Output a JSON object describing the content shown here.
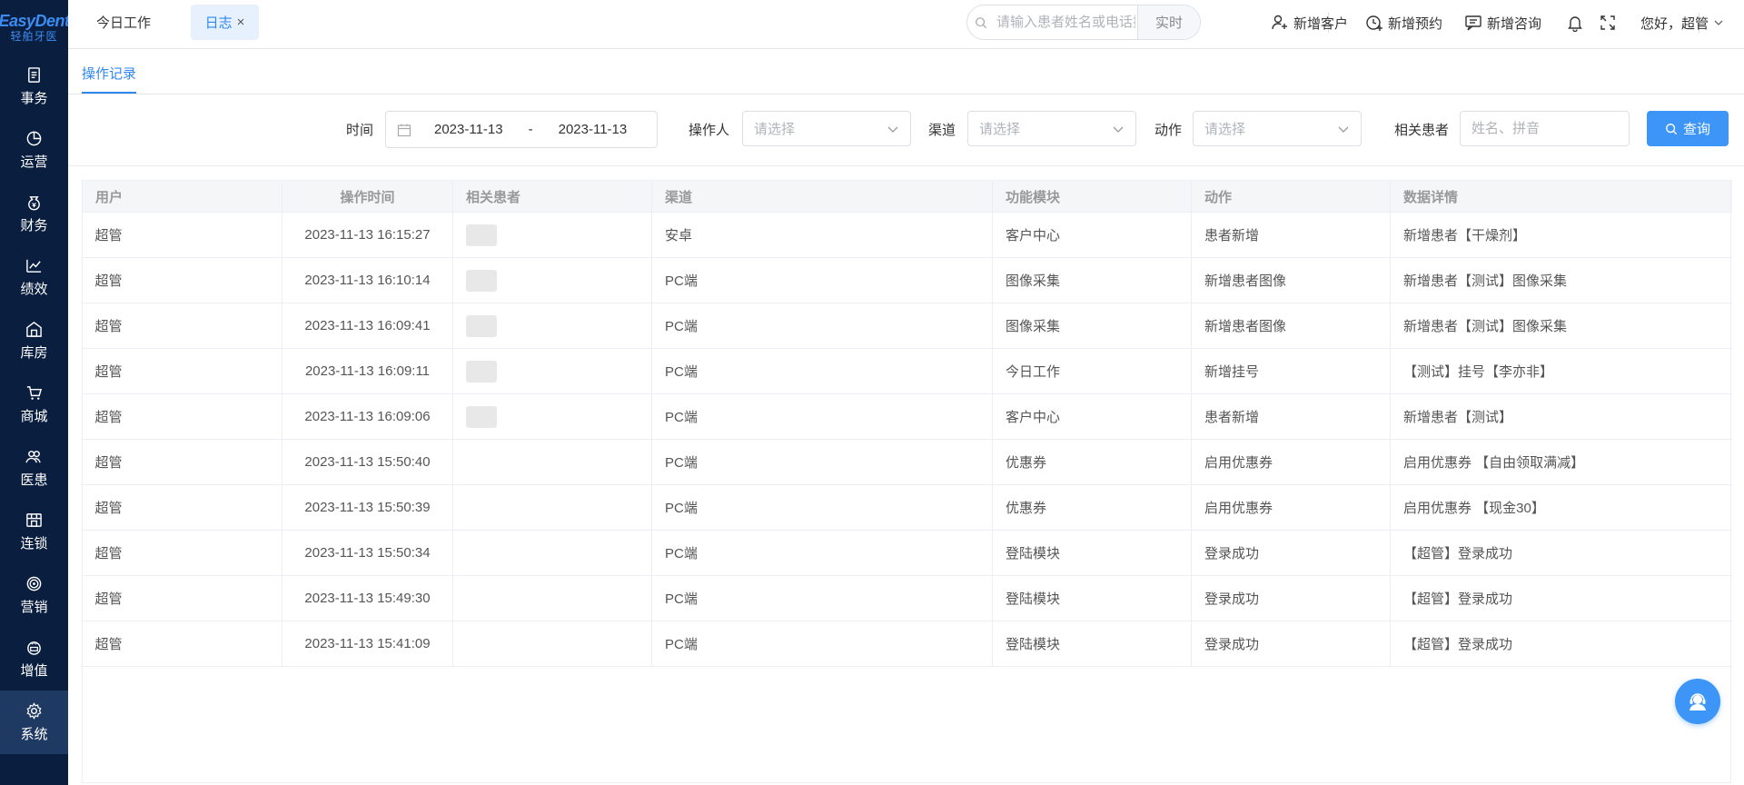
{
  "brand": {
    "name": "EasyDent",
    "subtitle": "轻舶牙医",
    "accent": "#3b8cf0"
  },
  "sidebar": {
    "items": [
      {
        "label": "事务",
        "icon": "clipboard-icon"
      },
      {
        "label": "运营",
        "icon": "pie-chart-icon"
      },
      {
        "label": "财务",
        "icon": "money-bag-icon"
      },
      {
        "label": "绩效",
        "icon": "line-chart-icon"
      },
      {
        "label": "库房",
        "icon": "warehouse-icon"
      },
      {
        "label": "商城",
        "icon": "cart-icon"
      },
      {
        "label": "医患",
        "icon": "people-icon"
      },
      {
        "label": "连锁",
        "icon": "store-icon"
      },
      {
        "label": "营销",
        "icon": "target-icon"
      },
      {
        "label": "增值",
        "icon": "gift-icon"
      },
      {
        "label": "系统",
        "icon": "gear-icon"
      }
    ],
    "active": "系统"
  },
  "topbar": {
    "tab_home": "今日工作",
    "tab_active": "日志",
    "tab_close": "×",
    "search": {
      "placeholder": "请输入患者姓名或电话搜索",
      "button": "实时"
    },
    "actions": {
      "add_customer": "新增客户",
      "add_appointment": "新增预约",
      "add_consult": "新增咨询"
    },
    "greeting": "您好，超管"
  },
  "subtab": {
    "label": "操作记录"
  },
  "filters": {
    "time_label": "时间",
    "date_start": "2023-11-13",
    "date_sep": "-",
    "date_end": "2023-11-13",
    "operator_label": "操作人",
    "operator_placeholder": "请选择",
    "channel_label": "渠道",
    "channel_placeholder": "请选择",
    "action_label": "动作",
    "action_placeholder": "请选择",
    "patient_label": "相关患者",
    "patient_placeholder": "姓名、拼音",
    "query_button": "查询"
  },
  "table": {
    "headers": [
      "用户",
      "操作时间",
      "相关患者",
      "渠道",
      "功能模块",
      "动作",
      "数据详情"
    ],
    "rows": [
      {
        "user": "超管",
        "time": "2023-11-13 16:15:27",
        "patient": "",
        "channel": "安卓",
        "module": "客户中心",
        "action": "患者新增",
        "detail": "新增患者【干燥剂】"
      },
      {
        "user": "超管",
        "time": "2023-11-13 16:10:14",
        "patient": "",
        "channel": "PC端",
        "module": "图像采集",
        "action": "新增患者图像",
        "detail": "新增患者【测试】图像采集"
      },
      {
        "user": "超管",
        "time": "2023-11-13 16:09:41",
        "patient": "",
        "channel": "PC端",
        "module": "图像采集",
        "action": "新增患者图像",
        "detail": "新增患者【测试】图像采集"
      },
      {
        "user": "超管",
        "time": "2023-11-13 16:09:11",
        "patient": "",
        "channel": "PC端",
        "module": "今日工作",
        "action": "新增挂号",
        "detail": "【测试】挂号【李亦非】"
      },
      {
        "user": "超管",
        "time": "2023-11-13 16:09:06",
        "patient": "",
        "channel": "PC端",
        "module": "客户中心",
        "action": "患者新增",
        "detail": "新增患者【测试】"
      },
      {
        "user": "超管",
        "time": "2023-11-13 15:50:40",
        "patient": "",
        "channel": "PC端",
        "module": "优惠券",
        "action": "启用优惠券",
        "detail": "启用优惠券 【自由领取满减】"
      },
      {
        "user": "超管",
        "time": "2023-11-13 15:50:39",
        "patient": "",
        "channel": "PC端",
        "module": "优惠券",
        "action": "启用优惠券",
        "detail": "启用优惠券 【现金30】"
      },
      {
        "user": "超管",
        "time": "2023-11-13 15:50:34",
        "patient": "",
        "channel": "PC端",
        "module": "登陆模块",
        "action": "登录成功",
        "detail": "【超管】登录成功"
      },
      {
        "user": "超管",
        "time": "2023-11-13 15:49:30",
        "patient": "",
        "channel": "PC端",
        "module": "登陆模块",
        "action": "登录成功",
        "detail": "【超管】登录成功"
      },
      {
        "user": "超管",
        "time": "2023-11-13 15:41:09",
        "patient": "",
        "channel": "PC端",
        "module": "登陆模块",
        "action": "登录成功",
        "detail": "【超管】登录成功"
      }
    ]
  },
  "colors": {
    "primary": "#3d95f7",
    "sidebar_bg": "#0a1e3f",
    "sidebar_active": "#1f3a62"
  }
}
